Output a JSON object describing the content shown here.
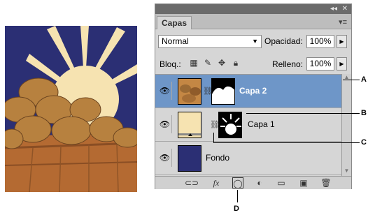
{
  "panel": {
    "topbar_collapse": "◂◂",
    "topbar_close": "✕",
    "tab_label": "Capas",
    "menu_icon": "panel-menu-icon",
    "blend_mode": "Normal",
    "opacity_label": "Opacidad:",
    "opacity_value": "100%",
    "lock_label": "Bloq.:",
    "fill_label": "Relleno:",
    "fill_value": "100%"
  },
  "layers": [
    {
      "name": "Capa 2",
      "selected": true,
      "has_mask": true,
      "linked": true
    },
    {
      "name": "Capa 1",
      "selected": false,
      "has_mask": true,
      "linked": true
    },
    {
      "name": "Fondo",
      "selected": false,
      "has_mask": false,
      "linked": false
    }
  ],
  "bottom_toolbar": {
    "fx_label": "fx"
  },
  "callouts": {
    "a": "A",
    "b": "B",
    "c": "C",
    "d": "D"
  },
  "colors": {
    "selected_row": "#6e96c8",
    "fondo_fill": "#2b2f74",
    "capa1_fill": "#f6e3b1"
  }
}
